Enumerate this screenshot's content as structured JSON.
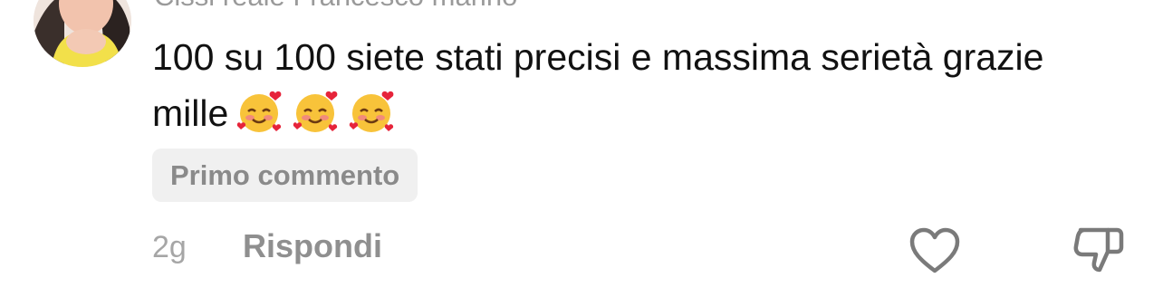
{
  "comment": {
    "author": "Cissi reale Francesco marino",
    "text": "100 su 100 siete stati precisi e massima serietà grazie mille",
    "emoji_name": "smiling-face-with-hearts-emoji",
    "badge": "Primo commento",
    "time": "2g",
    "reply_label": "Rispondi",
    "like_icon": "heart-icon",
    "dislike_icon": "thumbs-down-icon"
  },
  "colors": {
    "text": "#111111",
    "secondary": "#8f8f8f",
    "badge_bg": "#f0f0f0",
    "icon": "#7a7a7a"
  }
}
